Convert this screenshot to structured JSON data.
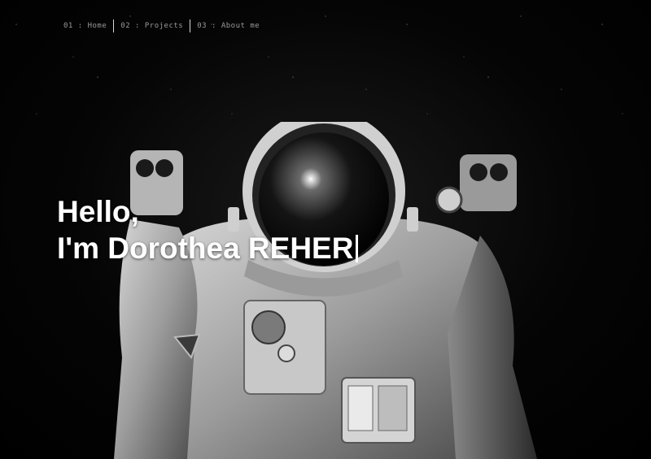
{
  "nav": {
    "items": [
      {
        "label": "01 : Home"
      },
      {
        "label": "02 : Projects"
      },
      {
        "label": "03 : About me"
      }
    ]
  },
  "hero": {
    "greeting": "Hello,",
    "intro": "I'm Dorothea REHER",
    "image_subject": "astronaut"
  },
  "colors": {
    "background": "#000000",
    "headline": "#ffffff",
    "nav_text": "#9a9a9a"
  }
}
